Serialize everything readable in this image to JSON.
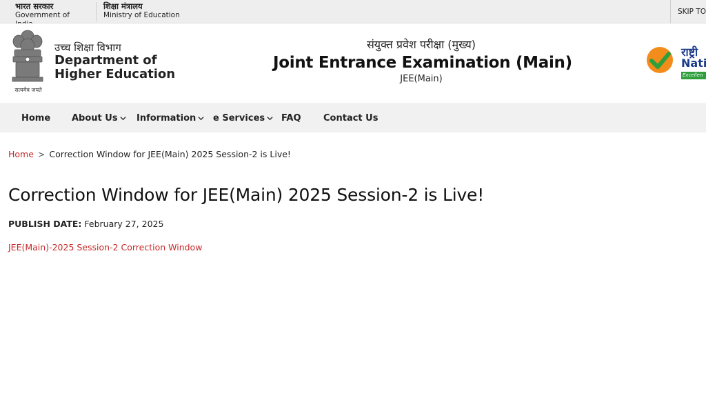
{
  "gov_strip": {
    "govt_hi": "भारत सरकार",
    "govt_en": "Government of India",
    "ministry_hi": "शिक्षा मंत्रालय",
    "ministry_en": "Ministry of Education",
    "skip_label": "SKIP TO"
  },
  "header": {
    "emblem_motto": "सत्यमेव जयते",
    "dept_hi": "उच्च शिक्षा विभाग",
    "dept_en": "Department of Higher Education",
    "exam_hi": "संयुक्त प्रवेश परीक्षा (मुख्य)",
    "exam_en": "Joint Entrance Examination (Main)",
    "exam_short": "JEE(Main)",
    "nta_hi": "राष्ट्री",
    "nta_en": "Nati",
    "nta_tag": "Excellen"
  },
  "nav": {
    "items": [
      {
        "label": "Home",
        "has_dropdown": false
      },
      {
        "label": "About Us",
        "has_dropdown": true
      },
      {
        "label": "Information",
        "has_dropdown": true
      },
      {
        "label": "e Services",
        "has_dropdown": true
      },
      {
        "label": "FAQ",
        "has_dropdown": false
      },
      {
        "label": "Contact Us",
        "has_dropdown": false
      }
    ]
  },
  "breadcrumb": {
    "home": "Home",
    "separator": ">",
    "current": "Correction Window for JEE(Main) 2025 Session-2 is Live!"
  },
  "article": {
    "title": "Correction Window for JEE(Main) 2025 Session-2 is Live!",
    "publish_label": "PUBLISH DATE:",
    "publish_date": "February 27, 2025",
    "link_text": "JEE(Main)-2025 Session-2 Correction Window"
  },
  "colors": {
    "link_red": "#c62828",
    "nav_bg": "#f1f1f1",
    "strip_bg": "#eeeeee",
    "nta_blue": "#1a3a8a",
    "nta_green": "#2f9e3d"
  }
}
